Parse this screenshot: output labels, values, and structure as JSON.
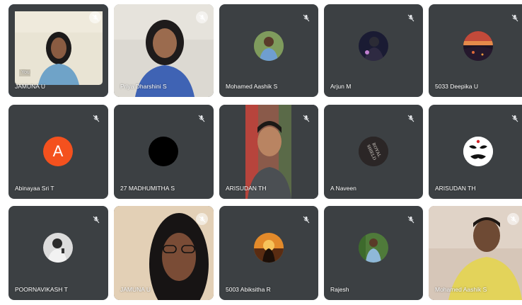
{
  "meeting": {
    "participants": [
      {
        "name": "JAMUNA U",
        "self_label": "You",
        "muted": true
      },
      {
        "name": "Priya Dharshini S",
        "muted": true
      },
      {
        "name": "Mohamed Aashik S",
        "muted": true
      },
      {
        "name": "Arjun M",
        "muted": true
      },
      {
        "name": "5033 Deepika U",
        "muted": true
      },
      {
        "name": "Abinayaa Sri T",
        "avatar_letter": "A",
        "muted": true
      },
      {
        "name": "27 MADHUMITHA S",
        "muted": true
      },
      {
        "name": "ARISUDAN TH",
        "muted": true
      },
      {
        "name": "A Naveen",
        "avatar_text": "ROYAL SHIELD",
        "muted": true
      },
      {
        "name": "ARISUDAN TH",
        "muted": true
      },
      {
        "name": "POORNAVIKASH T",
        "muted": true
      },
      {
        "name": "JAMUNA U",
        "muted": true
      },
      {
        "name": "5003 Abiksitha R",
        "muted": true
      },
      {
        "name": "Rajesh",
        "muted": true
      },
      {
        "name": "Mohamed Aashik S",
        "muted": true
      }
    ]
  },
  "colors": {
    "tile_bg": "#3c4043",
    "active_border": "#8ab4f8",
    "avatar_orange": "#f4511e"
  },
  "icons": {
    "mic_off": "mic-off-icon"
  }
}
